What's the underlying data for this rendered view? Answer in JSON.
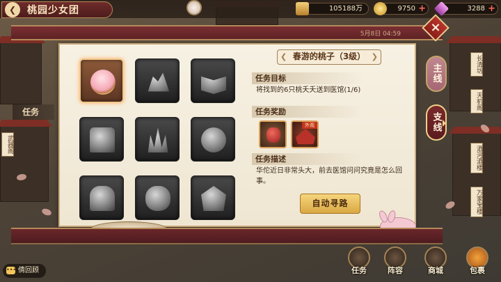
{
  "header": {
    "title": "桃园少女团",
    "back_icon": "chevron-left-icon"
  },
  "resources": [
    {
      "name": "power",
      "value": "105188万",
      "icon": "gold-ingot-icon",
      "color": "#d9a843"
    },
    {
      "name": "gold",
      "value": "9750",
      "icon": "coin-icon",
      "color": "#e8b64a"
    },
    {
      "name": "gems",
      "value": "3288",
      "icon": "gem-icon",
      "color": "#d96ad1"
    }
  ],
  "frame": {
    "date_text": "5月8日 04:59"
  },
  "side_tabs": {
    "main": "主线",
    "branch": "支线"
  },
  "left_label": "任务",
  "quest": {
    "title": "春游的桃子（3级）",
    "objective_heading": "任务目标",
    "objective_text": "将找到的6只桃夭夭送到医馆(1/6)",
    "reward_heading": "任务奖励",
    "reward_badge": "外观",
    "description_heading": "任务描述",
    "description_text": "华佗近日非常头大，前去医馆问问究竟是怎么回事。",
    "auto_button": "自动寻路"
  },
  "bottom_nav": {
    "chat": "倩回顾",
    "items": [
      "任务",
      "阵容",
      "商城",
      "包裹"
    ]
  },
  "map_tags": [
    "武器阁",
    "长清坊",
    "天机阁",
    "酒河酒楼",
    "万家宝楼"
  ]
}
